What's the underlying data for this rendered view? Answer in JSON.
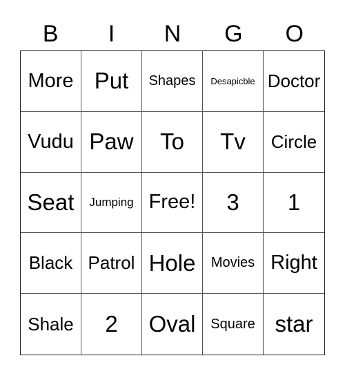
{
  "header": {
    "letters": [
      "B",
      "I",
      "N",
      "G",
      "O"
    ]
  },
  "grid": {
    "rows": [
      [
        "More",
        "Put",
        "Shapes",
        "Desapicble",
        "Doctor"
      ],
      [
        "Vudu",
        "Paw",
        "To",
        "Tv",
        "Circle"
      ],
      [
        "Seat",
        "Jumping",
        "Free!",
        "3",
        "1"
      ],
      [
        "Black",
        "Patrol",
        "Hole",
        "Movies",
        "Right"
      ],
      [
        "Shale",
        "2",
        "Oval",
        "Square",
        "star"
      ]
    ]
  }
}
